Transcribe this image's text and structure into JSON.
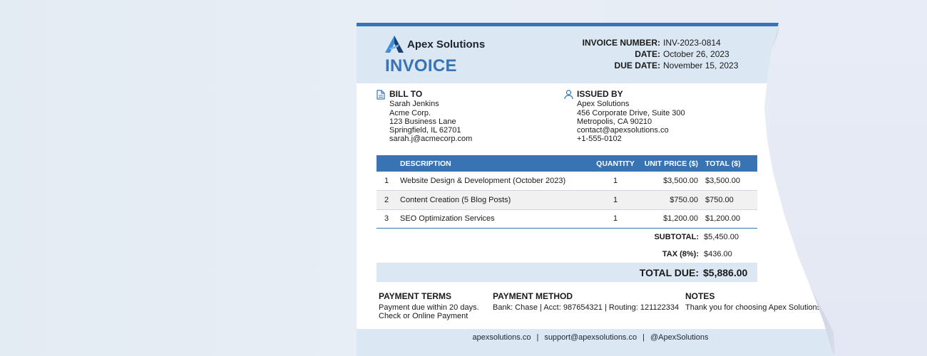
{
  "brand": {
    "name": "Apex Solutions",
    "logo_icon": "mountain-a-logo"
  },
  "title": "INVOICE",
  "meta": {
    "invoice_number_label": "INVOICE NUMBER:",
    "invoice_number": "INV-2023-0814",
    "date_label": "DATE:",
    "date": "October 26, 2023",
    "due_date_label": "DUE DATE:",
    "due_date": "November 15, 2023"
  },
  "bill_to": {
    "heading": "BILL TO",
    "icon": "document-icon",
    "lines": [
      "Sarah Jenkins",
      "Acme Corp.",
      "123 Business Lane",
      "Springfield, IL 62701",
      "sarah.j@acmecorp.com"
    ]
  },
  "issued_by": {
    "heading": "ISSUED BY",
    "icon": "user-icon",
    "lines": [
      "Apex Solutions",
      "456 Corporate Drive, Suite 300",
      "Metropolis, CA 90210",
      "contact@apexsolutions.co",
      "+1-555-0102"
    ]
  },
  "table": {
    "headers": [
      "",
      "DESCRIPTION",
      "QUANTITY",
      "UNIT PRICE ($)",
      "TOTAL ($)"
    ],
    "rows": [
      {
        "num": "1",
        "description": "Website Design & Development (October 2023)",
        "quantity": "1",
        "unit_price": "$3,500.00",
        "total": "$3,500.00"
      },
      {
        "num": "2",
        "description": "Content Creation (5 Blog Posts)",
        "quantity": "1",
        "unit_price": "$750.00",
        "total": "$750.00"
      },
      {
        "num": "3",
        "description": "SEO Optimization Services",
        "quantity": "1",
        "unit_price": "$1,200.00",
        "total": "$1,200.00"
      }
    ]
  },
  "summary": {
    "subtotal_label": "SUBTOTAL:",
    "subtotal": "$5,450.00",
    "tax_label": "TAX (8%):",
    "tax": "$436.00",
    "total_label": "TOTAL DUE:",
    "total": "$5,886.00"
  },
  "payment_terms": {
    "heading": "PAYMENT TERMS",
    "lines": [
      "Payment due within 20 days.",
      "Check or Online Payment"
    ]
  },
  "payment_method": {
    "heading": "PAYMENT METHOD",
    "text": "Bank: Chase | Acct: 987654321 | Routing: 121122334"
  },
  "notes": {
    "heading": "NOTES",
    "text": "Thank you for choosing Apex Solutions!"
  },
  "footer": {
    "website": "apexsolutions.co",
    "email": "support@apexsolutions.co",
    "social": "@ApexSolutions",
    "separator": "|"
  },
  "colors": {
    "accent": "#3874b3",
    "band": "#dbe8f3",
    "background": "#e6edf5"
  }
}
